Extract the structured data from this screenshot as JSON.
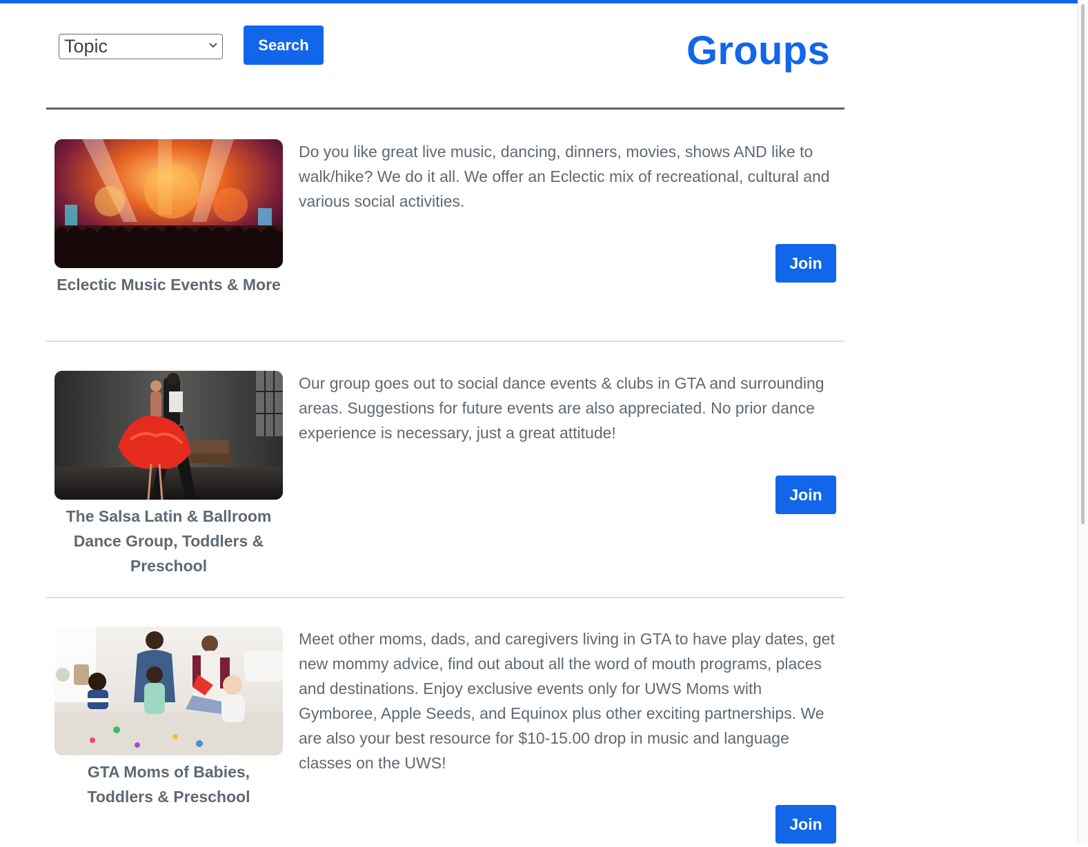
{
  "header": {
    "title": "Groups",
    "topic_select": {
      "selected": "Topic"
    },
    "search_label": "Search"
  },
  "colors": {
    "accent": "#1266ea",
    "text": "#5f6874",
    "divider": "#dcdfe3"
  },
  "groups": [
    {
      "name": "Eclectic Music Events & More",
      "description": "Do you like great live music, dancing, dinners, movies, shows AND like to walk/hike? We do it all. We offer an Eclectic mix of recreational, cultural and various social activities.",
      "join_label": "Join",
      "image": "concert-crowd-photo"
    },
    {
      "name": "The Salsa Latin & Ballroom Dance Group, Toddlers & Preschool",
      "description": "Our group goes out to social dance events & clubs in GTA and surrounding areas. Suggestions for future events are also appreciated. No prior dance experience is necessary, just a great attitude!",
      "join_label": "Join",
      "image": "dancing-couple-photo"
    },
    {
      "name": "GTA Moms of Babies, Toddlers & Preschool",
      "description": "Meet other moms, dads, and caregivers living in GTA to have play dates, get new mommy advice, find out about all the word of mouth programs, places and destinations. Enjoy exclusive events only for UWS Moms with Gymboree, Apple Seeds, and Equinox plus other exciting partnerships. We are also your best resource for $10-15.00 drop in music and language classes on the UWS!",
      "join_label": "Join",
      "image": "moms-with-toddlers-photo"
    }
  ]
}
